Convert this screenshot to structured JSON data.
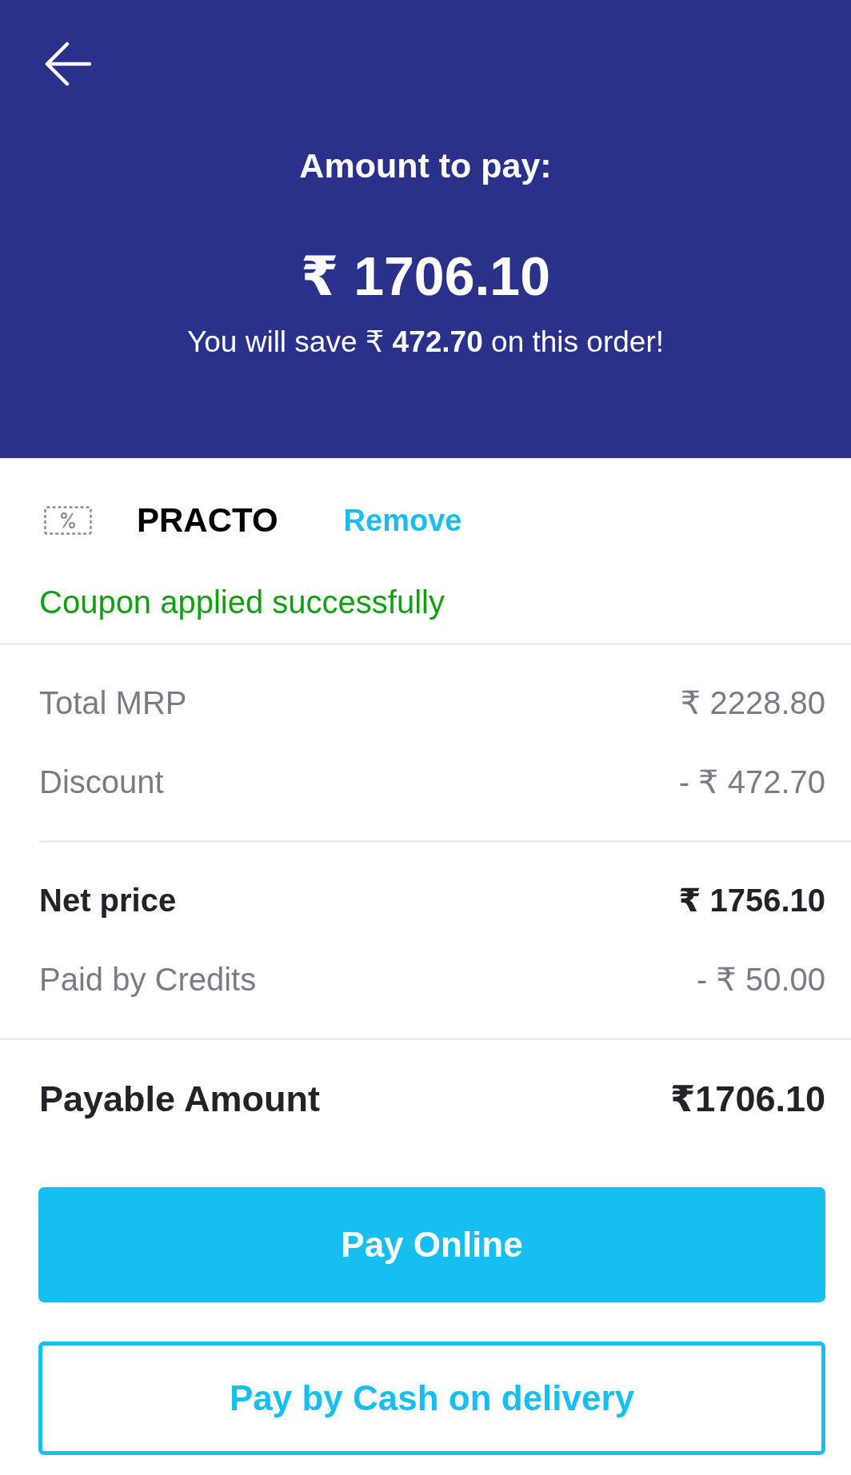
{
  "header": {
    "title": "Amount to pay:",
    "amount": "₹ 1706.10",
    "savings_note": "You will save ₹ **472.70** on this order!"
  },
  "coupon": {
    "code": "PRACTO",
    "remove_link": "Remove",
    "status": "Coupon applied successfully"
  },
  "summary": {
    "groups": [
      {
        "rows": [
          {
            "label": "Total MRP",
            "value": "₹ 2228.80",
            "kind": "regular"
          },
          {
            "label": "Discount",
            "value": "- ₹ 472.70",
            "kind": "regular"
          }
        ]
      },
      {
        "rows": [
          {
            "label": "Net price",
            "value": "₹ 1756.10",
            "kind": "emphasis"
          },
          {
            "label": "Paid by Credits",
            "value": "- ₹ 50.00",
            "kind": "regular"
          }
        ]
      }
    ],
    "payable": {
      "label": "Payable Amount",
      "value": "₹1706.10"
    }
  },
  "buttons": [
    {
      "label": "Pay Online",
      "kind": "primary"
    },
    {
      "label": "Pay by Cash on delivery",
      "kind": "outline"
    }
  ]
}
